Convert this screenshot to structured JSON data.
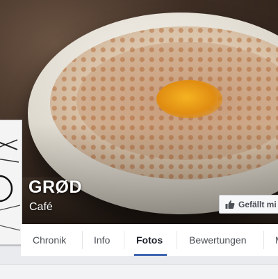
{
  "page": {
    "name": "GRØD",
    "category": "Café"
  },
  "actions": {
    "like_label": "Gefällt mi"
  },
  "tabs": [
    {
      "label": "Chronik",
      "active": false
    },
    {
      "label": "Info",
      "active": false
    },
    {
      "label": "Fotos",
      "active": true
    },
    {
      "label": "Bewertungen",
      "active": false
    },
    {
      "label": "M",
      "active": false
    }
  ],
  "colors": {
    "accent": "#4267b2",
    "tab_text": "#4b4f56",
    "background": "#e9ebee"
  },
  "icons": {
    "like": "thumbs-up-icon"
  }
}
